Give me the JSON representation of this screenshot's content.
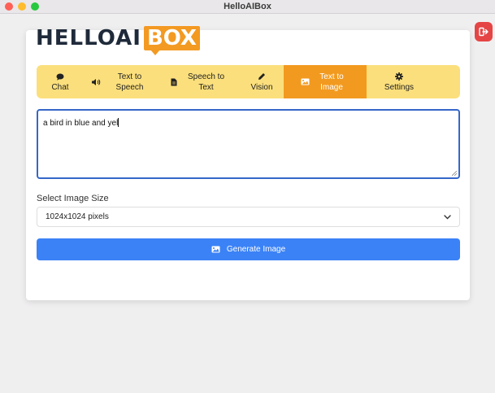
{
  "window": {
    "title": "HelloAIBox"
  },
  "logo": {
    "part1": "HELLOAI",
    "part2": "BOX"
  },
  "tabs": [
    {
      "label": "Chat",
      "icon": "comment-icon",
      "active": false
    },
    {
      "label": "Text to Speech",
      "icon": "volume-icon",
      "active": false
    },
    {
      "label": "Speech to Text",
      "icon": "file-icon",
      "active": false
    },
    {
      "label": "Vision",
      "icon": "pencil-icon",
      "active": false
    },
    {
      "label": "Text to Image",
      "icon": "image-icon",
      "active": true
    },
    {
      "label": "Settings",
      "icon": "gear-icon",
      "active": false
    }
  ],
  "prompt": {
    "value": "a bird in blue and yel"
  },
  "image_size": {
    "label": "Select Image Size",
    "selected": "1024x1024 pixels"
  },
  "generate_button": {
    "label": "Generate Image"
  },
  "colors": {
    "tab_bar": "#fbdf7c",
    "tab_active": "#f29a1f",
    "button": "#3b82f6",
    "logout": "#e54545",
    "focus_border": "#3567c9"
  }
}
